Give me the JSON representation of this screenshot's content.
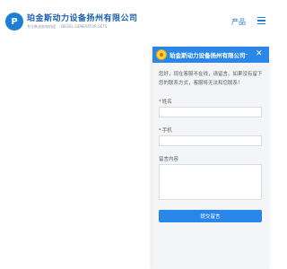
{
  "header": {
    "brand_title": "珀金斯动力设备扬州有限公司",
    "brand_subtitle_cn": "专注柴油发电机组",
    "brand_subtitle_en": "DIESEL GENERATOR SETS",
    "nav_item": "产品",
    "accent_color": "#1c7fd6"
  },
  "chat_panel": {
    "title": "珀金斯动力设备扬州有限公司",
    "minimize_symbol": "–",
    "close_symbol": "✕",
    "greeting": "您好，现在客服不在线，请留言。如果没有留下您的联系方式，客服将无法和您联系！",
    "fields": [
      {
        "label": "姓名",
        "required": true,
        "value": ""
      },
      {
        "label": "手机",
        "required": true,
        "value": ""
      }
    ],
    "message_label": "留言内容",
    "message_value": "",
    "submit_label": "提交留言",
    "header_color": "#2a86e8"
  }
}
